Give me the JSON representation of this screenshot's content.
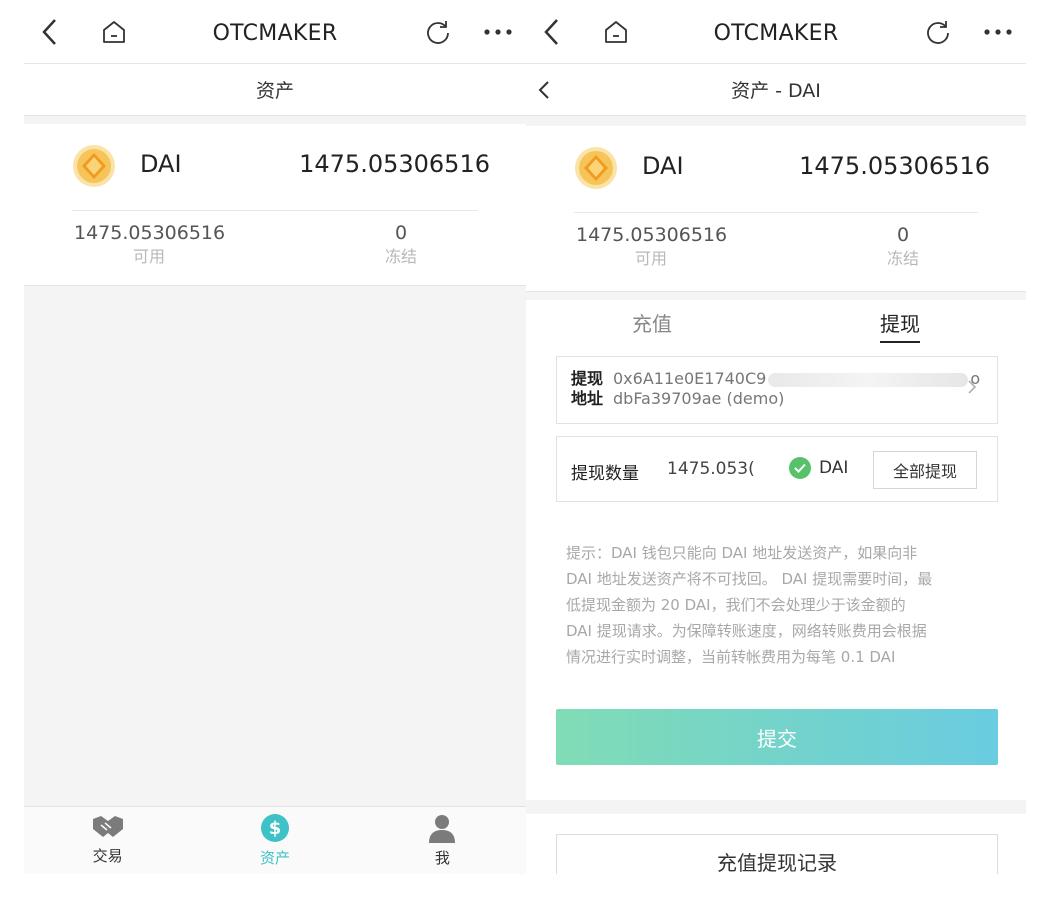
{
  "app": {
    "title": "OTCMAKER"
  },
  "left": {
    "page_title": "资产",
    "asset": {
      "name": "DAI",
      "total": "1475.05306516",
      "available_value": "1475.05306516",
      "available_label": "可用",
      "frozen_value": "0",
      "frozen_label": "冻结"
    },
    "tabbar": [
      {
        "label": "交易",
        "icon": "handshake-icon"
      },
      {
        "label": "资产",
        "icon": "dollar-coin-icon"
      },
      {
        "label": "我",
        "icon": "person-icon"
      }
    ],
    "active_tab": "资产"
  },
  "right": {
    "page_title": "资产 - DAI",
    "asset": {
      "name": "DAI",
      "total": "1475.05306516",
      "available_value": "1475.05306516",
      "available_label": "可用",
      "frozen_value": "0",
      "frozen_label": "冻结"
    },
    "tabs": {
      "deposit": "充值",
      "withdraw": "提现",
      "active": "提现"
    },
    "address": {
      "label_line1": "提现",
      "label_line2": "地址",
      "value_part1": "0x6A11e0E1740C9",
      "value_part2": "o",
      "value_line2": "dbFa39709ae (demo)"
    },
    "amount": {
      "label": "提现数量",
      "value": "1475.053(",
      "coin": "DAI",
      "all_button": "全部提现"
    },
    "notice": [
      "提示：DAI 钱包只能向 DAI 地址发送资产，如果向非",
      "DAI 地址发送资产将不可找回。 DAI 提现需要时间，最",
      "低提现金额为 20 DAI，我们不会处理少于该金额的",
      "DAI 提现请求。为保障转账速度，网络转账费用会根据",
      "情况进行实时调整，当前转帐费用为每笔 0.1 DAI"
    ],
    "submit_label": "提交",
    "records_label": "充值提现记录"
  },
  "colors": {
    "accent": "#3ec2c7",
    "coin_gold": "#f2b53b",
    "submit_gradient_start": "#6ad6a8",
    "submit_gradient_end": "#4fc3db",
    "check_green": "#56c26a"
  }
}
